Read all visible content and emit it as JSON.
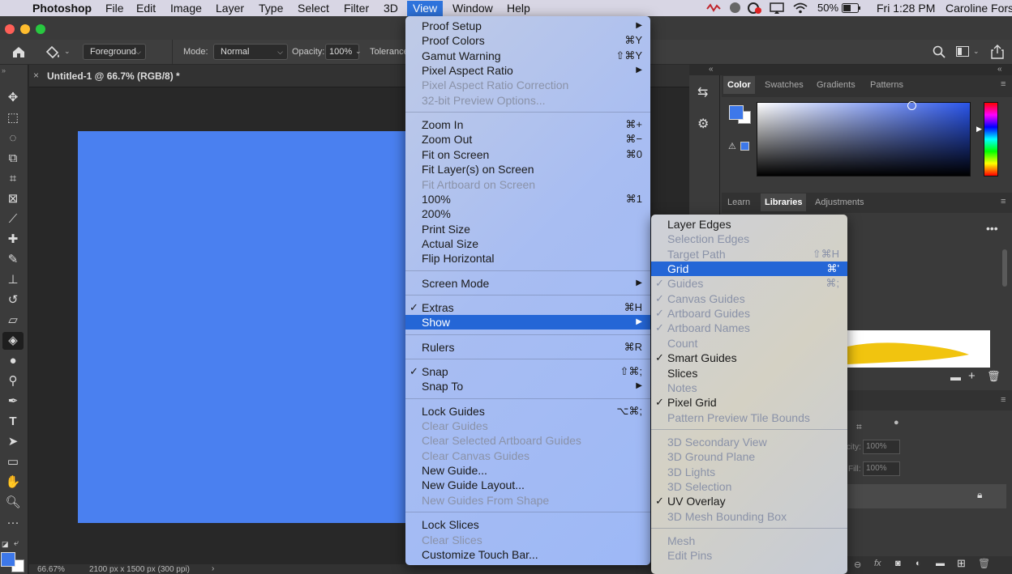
{
  "menubar": {
    "apple": "",
    "items": [
      "Photoshop",
      "File",
      "Edit",
      "Image",
      "Layer",
      "Type",
      "Select",
      "Filter",
      "3D",
      "View",
      "Window",
      "Help"
    ],
    "status": {
      "battery": "50%",
      "clock": "Fri 1:28 PM",
      "user": "Caroline Fors"
    }
  },
  "options": {
    "fill_source": "Foreground",
    "mode_label": "Mode:",
    "mode_value": "Normal",
    "opacity_label": "Opacity:",
    "opacity_value": "100%",
    "tolerance_label": "Tolerance"
  },
  "document": {
    "tab_title": "Untitled-1 @ 66.7% (RGB/8) *",
    "zoom": "66.67%",
    "size": "2100 px x 1500 px (300 ppi)"
  },
  "panels": {
    "tabs1": [
      "Color",
      "Swatches",
      "Gradients",
      "Patterns"
    ],
    "tabs2": [
      "Learn",
      "Libraries",
      "Adjustments"
    ],
    "fill": "100%",
    "opacity": "100%",
    "fill_label": "Fill:",
    "opacity_label": "city:"
  },
  "view_menu": [
    {
      "label": "Proof Setup",
      "sc": "▶",
      "dis": false
    },
    {
      "label": "Proof Colors",
      "sc": "⌘Y",
      "dis": false
    },
    {
      "label": "Gamut Warning",
      "sc": "⇧⌘Y",
      "dis": false
    },
    {
      "label": "Pixel Aspect Ratio",
      "sc": "▶",
      "dis": false
    },
    {
      "label": "Pixel Aspect Ratio Correction",
      "sc": "",
      "dis": true
    },
    {
      "label": "32-bit Preview Options...",
      "sc": "",
      "dis": true
    },
    {
      "sep": true
    },
    {
      "label": "Zoom In",
      "sc": "⌘+",
      "dis": false
    },
    {
      "label": "Zoom Out",
      "sc": "⌘−",
      "dis": false
    },
    {
      "label": "Fit on Screen",
      "sc": "⌘0",
      "dis": false
    },
    {
      "label": "Fit Layer(s) on Screen",
      "sc": "",
      "dis": false
    },
    {
      "label": "Fit Artboard on Screen",
      "sc": "",
      "dis": true
    },
    {
      "label": "100%",
      "sc": "⌘1",
      "dis": false
    },
    {
      "label": "200%",
      "sc": "",
      "dis": false
    },
    {
      "label": "Print Size",
      "sc": "",
      "dis": false
    },
    {
      "label": "Actual Size",
      "sc": "",
      "dis": false
    },
    {
      "label": "Flip Horizontal",
      "sc": "",
      "dis": false
    },
    {
      "sep": true
    },
    {
      "label": "Screen Mode",
      "sc": "▶",
      "dis": false
    },
    {
      "sep": true
    },
    {
      "label": "Extras",
      "sc": "⌘H",
      "dis": false,
      "check": true
    },
    {
      "label": "Show",
      "sc": "▶",
      "dis": false,
      "sel": true
    },
    {
      "sep": true
    },
    {
      "label": "Rulers",
      "sc": "⌘R",
      "dis": false
    },
    {
      "sep": true
    },
    {
      "label": "Snap",
      "sc": "⇧⌘;",
      "dis": false,
      "check": true
    },
    {
      "label": "Snap To",
      "sc": "▶",
      "dis": false
    },
    {
      "sep": true
    },
    {
      "label": "Lock Guides",
      "sc": "⌥⌘;",
      "dis": false
    },
    {
      "label": "Clear Guides",
      "sc": "",
      "dis": true
    },
    {
      "label": "Clear Selected Artboard Guides",
      "sc": "",
      "dis": true
    },
    {
      "label": "Clear Canvas Guides",
      "sc": "",
      "dis": true
    },
    {
      "label": "New Guide...",
      "sc": "",
      "dis": false
    },
    {
      "label": "New Guide Layout...",
      "sc": "",
      "dis": false
    },
    {
      "label": "New Guides From Shape",
      "sc": "",
      "dis": true
    },
    {
      "sep": true
    },
    {
      "label": "Lock Slices",
      "sc": "",
      "dis": false
    },
    {
      "label": "Clear Slices",
      "sc": "",
      "dis": true
    },
    {
      "label": "Customize Touch Bar...",
      "sc": "",
      "dis": false
    }
  ],
  "show_menu": [
    {
      "label": "Layer Edges",
      "sc": "",
      "dis": false
    },
    {
      "label": "Selection Edges",
      "sc": "",
      "dis": true
    },
    {
      "label": "Target Path",
      "sc": "⇧⌘H",
      "dis": true
    },
    {
      "label": "Grid",
      "sc": "⌘'",
      "dis": false,
      "sel": true
    },
    {
      "label": "Guides",
      "sc": "⌘;",
      "dis": true,
      "check": true
    },
    {
      "label": "Canvas Guides",
      "sc": "",
      "dis": true,
      "check": true
    },
    {
      "label": "Artboard Guides",
      "sc": "",
      "dis": true,
      "check": true
    },
    {
      "label": "Artboard Names",
      "sc": "",
      "dis": true,
      "check": true
    },
    {
      "label": "Count",
      "sc": "",
      "dis": true
    },
    {
      "label": "Smart Guides",
      "sc": "",
      "dis": false,
      "check": true
    },
    {
      "label": "Slices",
      "sc": "",
      "dis": false
    },
    {
      "label": "Notes",
      "sc": "",
      "dis": true
    },
    {
      "label": "Pixel Grid",
      "sc": "",
      "dis": false,
      "check": true
    },
    {
      "label": "Pattern Preview Tile Bounds",
      "sc": "",
      "dis": true
    },
    {
      "sep": true
    },
    {
      "label": "3D Secondary View",
      "sc": "",
      "dis": true
    },
    {
      "label": "3D Ground Plane",
      "sc": "",
      "dis": true
    },
    {
      "label": "3D Lights",
      "sc": "",
      "dis": true
    },
    {
      "label": "3D Selection",
      "sc": "",
      "dis": true
    },
    {
      "label": "UV Overlay",
      "sc": "",
      "dis": false,
      "check": true
    },
    {
      "label": "3D Mesh Bounding Box",
      "sc": "",
      "dis": true
    },
    {
      "sep": true
    },
    {
      "label": "Mesh",
      "sc": "",
      "dis": true
    },
    {
      "label": "Edit Pins",
      "sc": "",
      "dis": true
    }
  ],
  "colors": {
    "canvas": "#4a80f0",
    "highlight": "#2466d6",
    "accent": "#2e73dc"
  }
}
